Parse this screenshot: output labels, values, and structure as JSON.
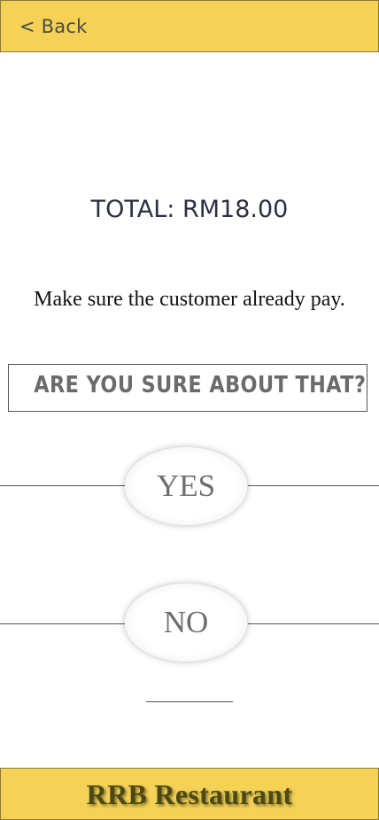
{
  "header": {
    "back_label": "< Back",
    "bar_color": "#f5d155"
  },
  "main": {
    "total_text": "TOTAL: RM18.00",
    "instruction": "Make sure the customer already pay.",
    "confirm_question": "ARE YOU SURE ABOUT THAT?",
    "yes_label": "YES",
    "no_label": "NO"
  },
  "footer": {
    "title": "RRB Restaurant",
    "bar_color": "#f5d155"
  }
}
